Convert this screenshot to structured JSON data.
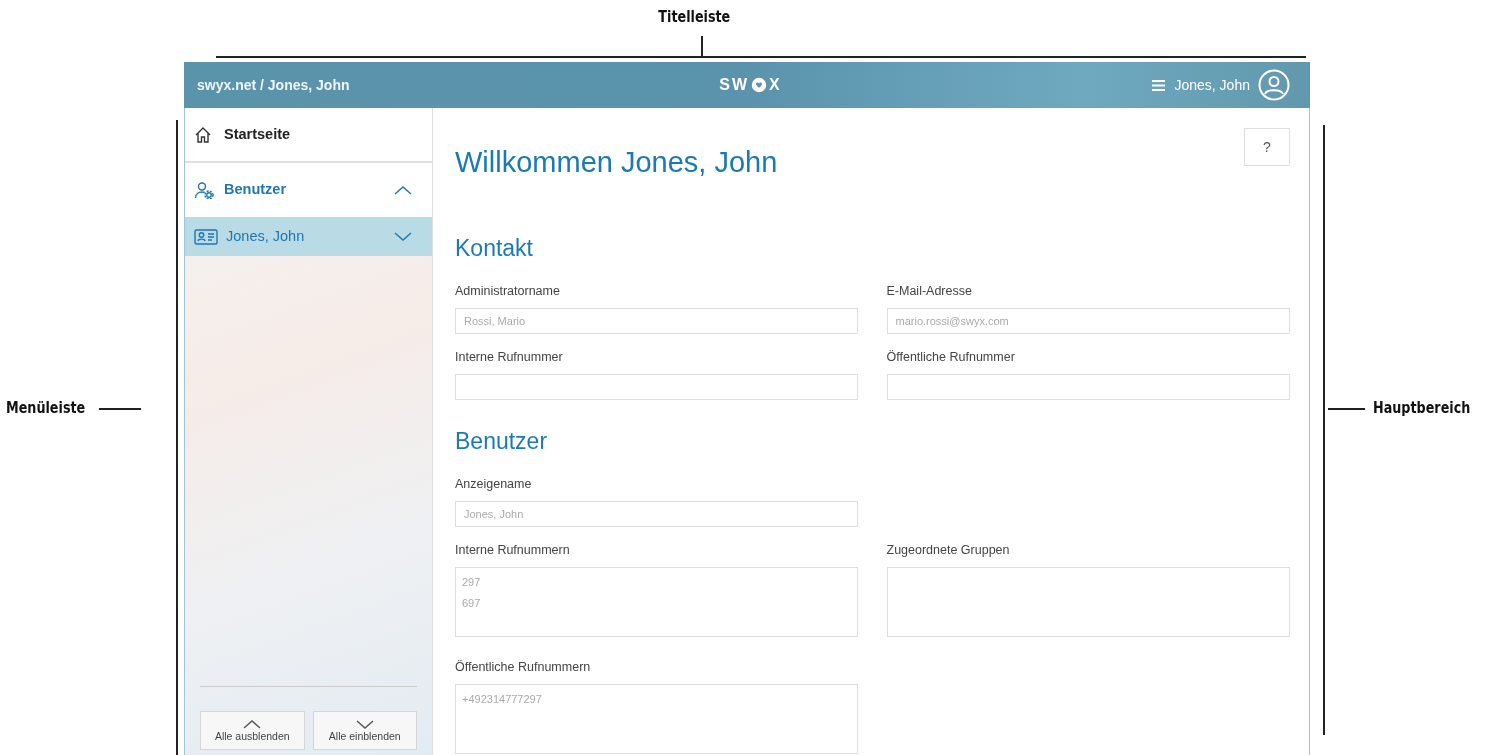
{
  "annotations": {
    "top": "Titelleiste",
    "left": "Menüleiste",
    "right": "Hauptbereich"
  },
  "titlebar": {
    "breadcrumb": "swyx.net / Jones, John",
    "logo": {
      "left": "SW",
      "right": "X"
    },
    "user": "Jones, John"
  },
  "sidebar": {
    "items": [
      {
        "label": "Startseite",
        "kind": "home",
        "selected": false
      },
      {
        "label": "Benutzer",
        "kind": "users",
        "selected": false,
        "expanded": true
      },
      {
        "label": "Jones, John",
        "kind": "user-card",
        "selected": true,
        "expanded": false
      }
    ],
    "buttons": [
      {
        "label": "Alle ausblenden",
        "kind": "collapse"
      },
      {
        "label": "Alle einblenden",
        "kind": "expand"
      }
    ]
  },
  "main": {
    "title": "Willkommen Jones, John",
    "help": "?",
    "sections": [
      {
        "heading": "Kontakt",
        "rows": [
          [
            {
              "label": "Administratorname",
              "kind": "input",
              "value": "Rossi, Mario"
            },
            {
              "label": "E-Mail-Adresse",
              "kind": "input",
              "value": "mario.rossi@swyx.com"
            }
          ],
          [
            {
              "label": "Interne Rufnummer",
              "kind": "input"
            },
            {
              "label": "Öffentliche Rufnummer",
              "kind": "input"
            }
          ]
        ]
      },
      {
        "heading": "Benutzer",
        "rows": [
          [
            {
              "label": "Anzeigename",
              "kind": "input",
              "value": "Jones, John"
            }
          ],
          [
            {
              "label": "Interne Rufnummern",
              "kind": "list",
              "lines": [
                "297",
                "697"
              ]
            },
            {
              "label": "Zugeordnete Gruppen",
              "kind": "list"
            }
          ],
          [
            {
              "label": "Öffentliche Rufnummern",
              "kind": "list",
              "lines": [
                "+492314777297"
              ]
            }
          ]
        ]
      }
    ]
  }
}
